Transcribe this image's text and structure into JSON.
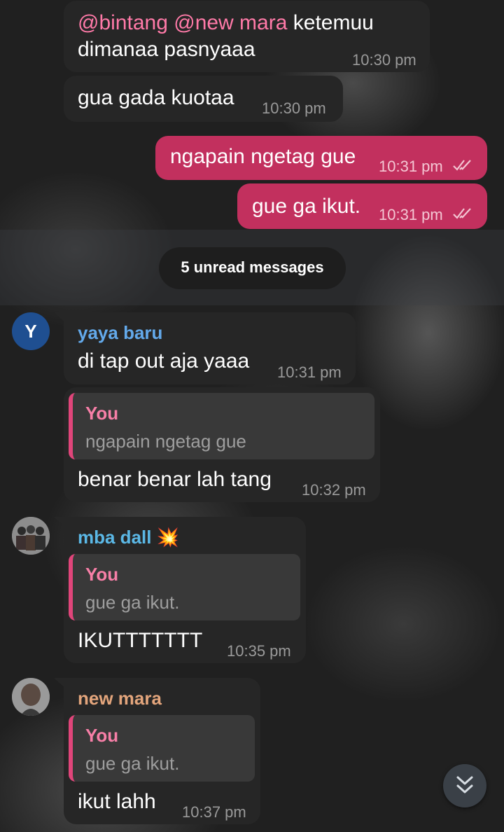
{
  "messages": {
    "m1": {
      "mentions": [
        "@bintang",
        "@new mara"
      ],
      "text_line1_rest": "ketemuu",
      "text_line2": "dimanaa pasnyaaa",
      "time": "10:30 pm"
    },
    "m2": {
      "text": "gua gada kuotaa",
      "time": "10:30 pm"
    },
    "m3": {
      "text": "ngapain ngetag gue",
      "time": "10:31 pm"
    },
    "m4": {
      "text": "gue ga ikut.",
      "time": "10:31 pm"
    },
    "unread": "5 unread messages",
    "m5": {
      "avatar_letter": "Y",
      "sender": "yaya baru",
      "text": "di tap out aja yaaa",
      "time": "10:31 pm"
    },
    "m6": {
      "quote_name": "You",
      "quote_text": "ngapain ngetag gue",
      "text": "benar benar lah tang",
      "time": "10:32 pm"
    },
    "m7": {
      "sender": "mba dall",
      "sender_emoji": "💥",
      "quote_name": "You",
      "quote_text": "gue ga ikut.",
      "text": "IKUTTTTTTT",
      "time": "10:35 pm"
    },
    "m8": {
      "sender": "new mara",
      "quote_name": "You",
      "quote_text": "gue ga ikut.",
      "text": "ikut lahh",
      "time": "10:37 pm"
    }
  },
  "colors": {
    "outgoing_bubble": "#c2305e",
    "incoming_bubble": "#262626",
    "mention": "#ff7aa8",
    "yaya_name": "#63a9ea",
    "mba_dall_name": "#5bb8e6",
    "new_mara_name": "#e3a57c",
    "quote_bar": "#e0457a"
  },
  "icons": {
    "read_ticks": "double-check-icon",
    "scroll_down": "double-chevron-down-icon"
  }
}
